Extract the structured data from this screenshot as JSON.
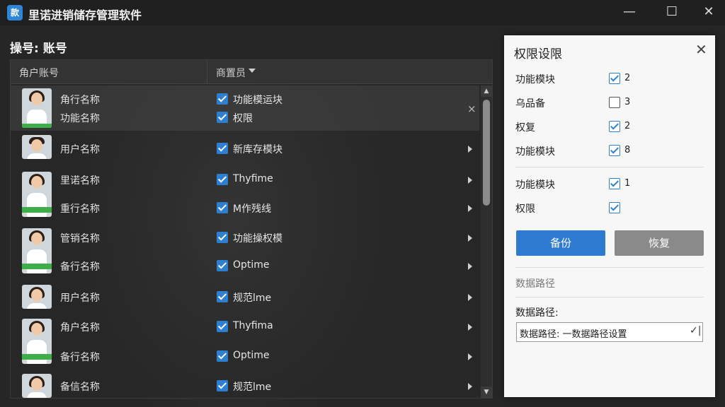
{
  "window": {
    "icon_text": "款",
    "title": "里诺进销储存管理软件",
    "minimize": "—",
    "maximize": "☐",
    "close": "✕"
  },
  "main": {
    "section_label": "操号: 账号",
    "table": {
      "col_account": "角户账号",
      "col_role": "商置员",
      "rows": [
        {
          "names": [
            "角行名称",
            "功能名称"
          ],
          "perms": [
            "功能模运块",
            "权限"
          ]
        },
        {
          "names": [
            "用户名称"
          ],
          "perms": [
            "新库存模块"
          ]
        },
        {
          "names": [
            "里诺名称",
            "重行名称"
          ],
          "perms": [
            "Thyfime",
            "M作残线"
          ]
        },
        {
          "names": [
            "管销名称",
            "备行名称"
          ],
          "perms": [
            "功能操权模",
            "Optime"
          ]
        },
        {
          "names": [
            "用户名称"
          ],
          "perms": [
            "规范lme"
          ]
        },
        {
          "names": [
            "角户名称",
            "备行名称"
          ],
          "perms": [
            "Thyfima",
            "Optime"
          ]
        },
        {
          "names": [
            "备信名称"
          ],
          "perms": [
            "规范lme"
          ]
        }
      ]
    }
  },
  "panel": {
    "title": "权限设限",
    "close": "✕",
    "items": [
      {
        "label": "功能模块",
        "checked": true,
        "value": "2"
      },
      {
        "label": "乌品备",
        "checked": false,
        "value": "3"
      },
      {
        "label": "权复",
        "checked": true,
        "value": "2"
      },
      {
        "label": "功能模块",
        "checked": true,
        "value": "8"
      },
      {
        "label": "功能模块",
        "checked": true,
        "value": "1"
      },
      {
        "label": "权限",
        "checked": true,
        "value": ""
      }
    ],
    "backup_button": "备份",
    "restore_button": "恢复",
    "section_label": "数据路径",
    "field_label": "数据路径:",
    "field_value": "数据路径: 一数据路径设置",
    "field_caret": "✓|"
  },
  "colors": {
    "accent": "#2f7bd1",
    "checkbox": "#2e7fd0",
    "restore": "#8a8a8a"
  }
}
